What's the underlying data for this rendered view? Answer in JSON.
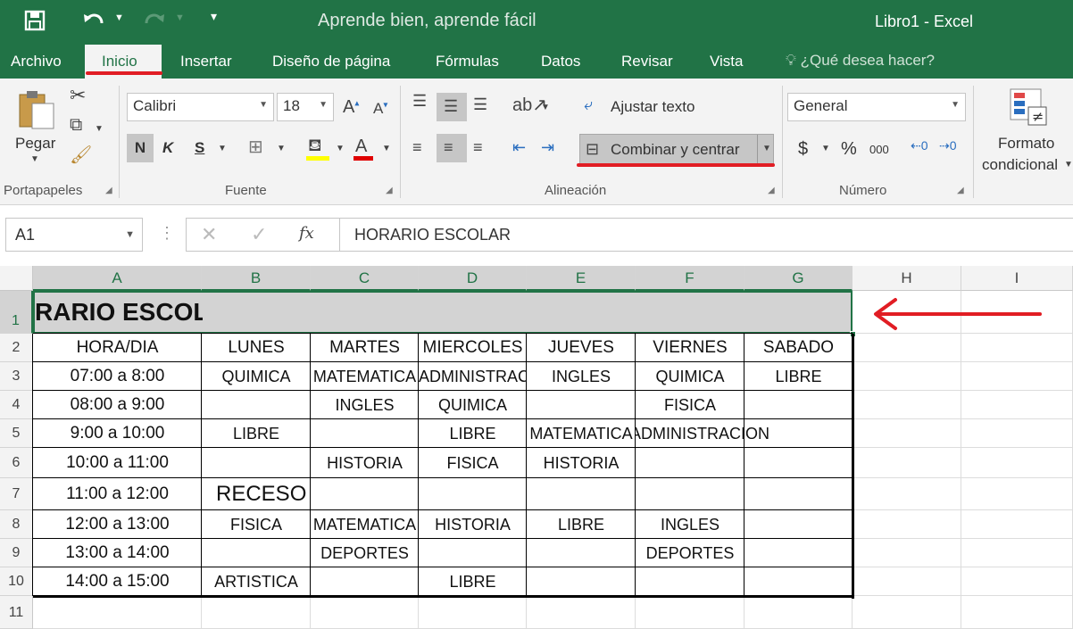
{
  "titlebar": {
    "doc_subtitle": "Aprende bien, aprende fácil",
    "app_title": "Libro1 - Excel",
    "save_icon": "save-icon",
    "undo_icon": "undo-icon",
    "redo_icon": "redo-icon"
  },
  "tabs": {
    "archivo": "Archivo",
    "inicio": "Inicio",
    "insertar": "Insertar",
    "diseno": "Diseño de página",
    "formulas": "Fórmulas",
    "datos": "Datos",
    "revisar": "Revisar",
    "vista": "Vista",
    "tellme": "¿Qué desea hacer?"
  },
  "ribbon": {
    "clipboard": {
      "paste": "Pegar",
      "label": "Portapapeles"
    },
    "font": {
      "name": "Calibri",
      "size": "18",
      "bold": "N",
      "italic": "K",
      "underline": "S",
      "label": "Fuente"
    },
    "alignment": {
      "wrap": "Ajustar texto",
      "merge": "Combinar y centrar",
      "label": "Alineación"
    },
    "number": {
      "format": "General",
      "currency": "$",
      "percent": "%",
      "thousands": "000",
      "label": "Número"
    },
    "styles": {
      "cond1": "Formato",
      "cond2": "condicional"
    }
  },
  "formula_bar": {
    "name_box": "A1",
    "formula": "HORARIO ESCOLAR",
    "fx": "fx"
  },
  "columns": [
    "A",
    "B",
    "C",
    "D",
    "E",
    "F",
    "G",
    "H",
    "I"
  ],
  "rows": [
    "1",
    "2",
    "3",
    "4",
    "5",
    "6",
    "7",
    "8",
    "9",
    "10",
    "11"
  ],
  "sheet": {
    "title": "HORARIO ESCOLAR",
    "title_visible": "RARIO ESCOLAR",
    "headers": [
      "HORA/DIA",
      "LUNES",
      "MARTES",
      "MIERCOLES",
      "JUEVES",
      "VIERNES",
      "SABADO"
    ],
    "body": [
      [
        "07:00 a 8:00",
        "QUIMICA",
        "MATEMATICA",
        "ADMINISTRACION",
        "INGLES",
        "QUIMICA",
        "LIBRE"
      ],
      [
        "08:00 a 9:00",
        "",
        "INGLES",
        "QUIMICA",
        "",
        "FISICA",
        ""
      ],
      [
        "9:00 a 10:00",
        "LIBRE",
        "",
        "LIBRE",
        "MATEMATICA",
        "ADMINISTRACION",
        ""
      ],
      [
        "10:00 a 11:00",
        "",
        "HISTORIA",
        "FISICA",
        "HISTORIA",
        "",
        ""
      ],
      [
        "11:00 a 12:00",
        "RECESO",
        "",
        "",
        "",
        "",
        ""
      ],
      [
        "12:00 a 13:00",
        "FISICA",
        "MATEMATICA",
        "HISTORIA",
        "LIBRE",
        "INGLES",
        ""
      ],
      [
        "13:00 a 14:00",
        "",
        "DEPORTES",
        "",
        "",
        "DEPORTES",
        ""
      ],
      [
        "14:00 a 15:00",
        "ARTISTICA",
        "",
        "LIBRE",
        "",
        "",
        ""
      ]
    ]
  },
  "colors": {
    "excel_green": "#217346",
    "annotation_red": "#e11d24",
    "selection_gray": "#d3d3d3"
  }
}
